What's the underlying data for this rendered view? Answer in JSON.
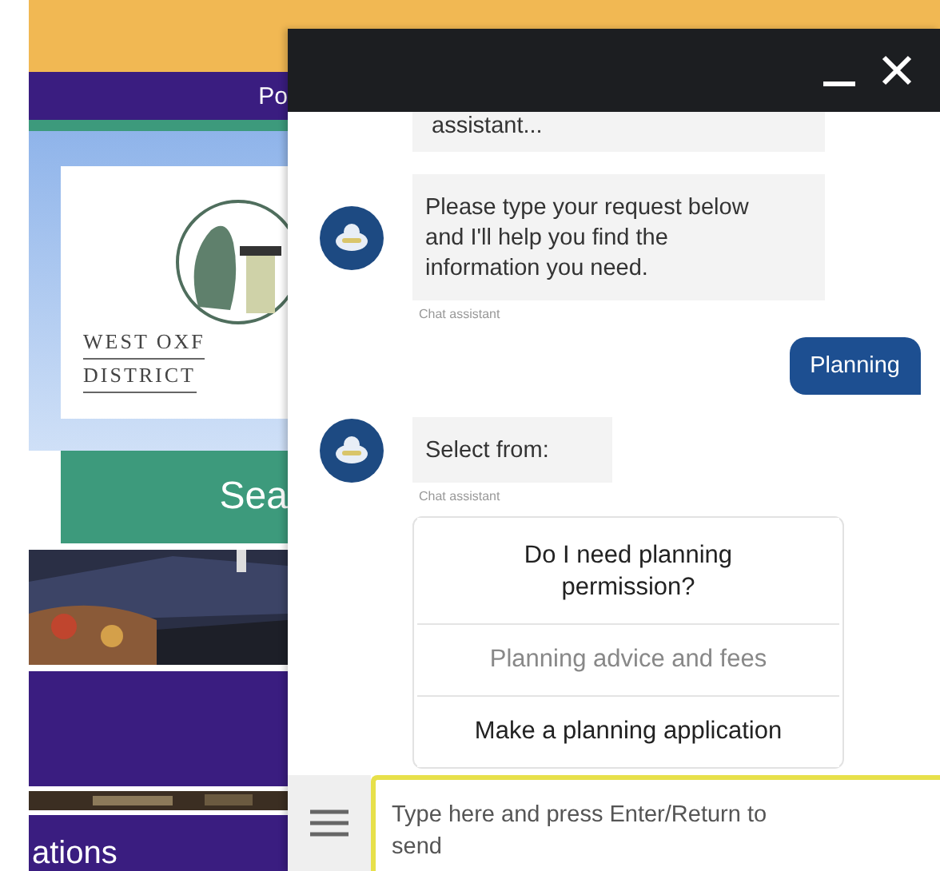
{
  "website": {
    "nav_text": "Po",
    "logo_lines": [
      "WEST OXF",
      "DISTRICT"
    ],
    "search_button": "Sea",
    "footer_text": "ations"
  },
  "chat": {
    "header": {
      "buttons": [
        {
          "kind": "minimize"
        },
        {
          "kind": "close"
        }
      ]
    },
    "messages": [
      {
        "kind": "bot",
        "text": "assistant...",
        "avatar": false
      },
      {
        "kind": "bot",
        "text": "Please type your request below and I'll help you find the information you need.",
        "avatar": true,
        "sender": "Chat assistant"
      },
      {
        "kind": "user",
        "text": "Planning"
      },
      {
        "kind": "bot",
        "text": "Select from:",
        "avatar": true,
        "sender": "Chat assistant"
      },
      {
        "kind": "options",
        "options": [
          {
            "label": "Do I need planning permission?",
            "dimmed": false
          },
          {
            "label": "Planning advice and fees",
            "dimmed": true
          },
          {
            "label": "Make a planning application",
            "dimmed": false
          }
        ]
      }
    ],
    "input": {
      "placeholder": "Type here and press Enter/Return to send"
    }
  }
}
